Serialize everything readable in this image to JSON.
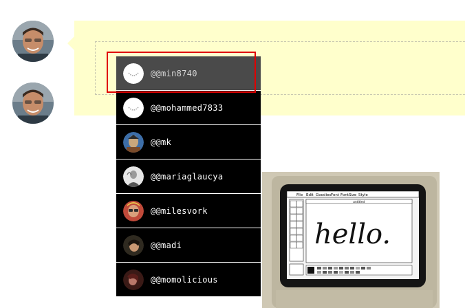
{
  "mentions": {
    "items": [
      {
        "label": "@@min8740",
        "avatar": "placeholder-avatar",
        "active": true
      },
      {
        "label": "@@mohammed7833",
        "avatar": "placeholder-avatar",
        "active": false
      },
      {
        "label": "@@mk",
        "avatar": "user-photo-avatar",
        "active": false
      },
      {
        "label": "@@mariaglaucya",
        "avatar": "user-photo-avatar",
        "active": false
      },
      {
        "label": "@@milesvork",
        "avatar": "user-photo-avatar",
        "active": false
      },
      {
        "label": "@@madi",
        "avatar": "user-photo-avatar",
        "active": false
      },
      {
        "label": "@@momolicious",
        "avatar": "user-photo-avatar",
        "active": false
      }
    ]
  },
  "photo": {
    "menu": [
      "File",
      "Edit",
      "Goodies",
      "Font",
      "FontSize",
      "Style"
    ],
    "window_title": "untitled",
    "text": "hello."
  },
  "colors": {
    "compose_bg": "#ffffcc",
    "dropdown_bg": "#000000",
    "dropdown_active": "#4a4a4a",
    "highlight": "#e00000"
  }
}
